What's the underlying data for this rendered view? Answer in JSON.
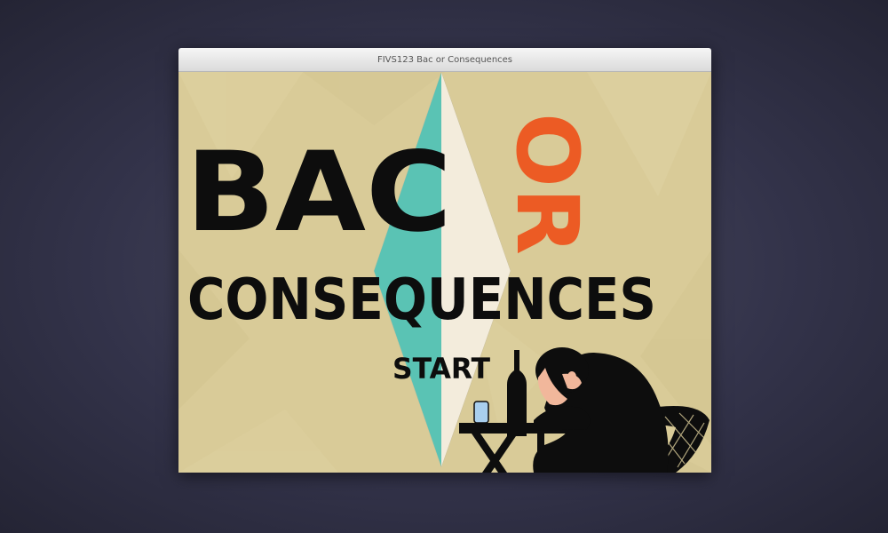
{
  "window": {
    "title": "FIVS123 Bac or Consequences"
  },
  "game": {
    "title_line1": "BAC",
    "title_or": "OR",
    "title_line2": "CONSEQUENCES",
    "start_label": "START"
  },
  "colors": {
    "background": "#d9cb98",
    "diamond_left": "#5ac3b4",
    "diamond_right": "#f3ecdc",
    "title_black": "#0d0d0d",
    "or_orange": "#ec5b24",
    "glass_blue": "#a9cfee",
    "skin": "#f1b79b"
  },
  "icons": {
    "figure": "drunk-man-at-table-silhouette"
  }
}
